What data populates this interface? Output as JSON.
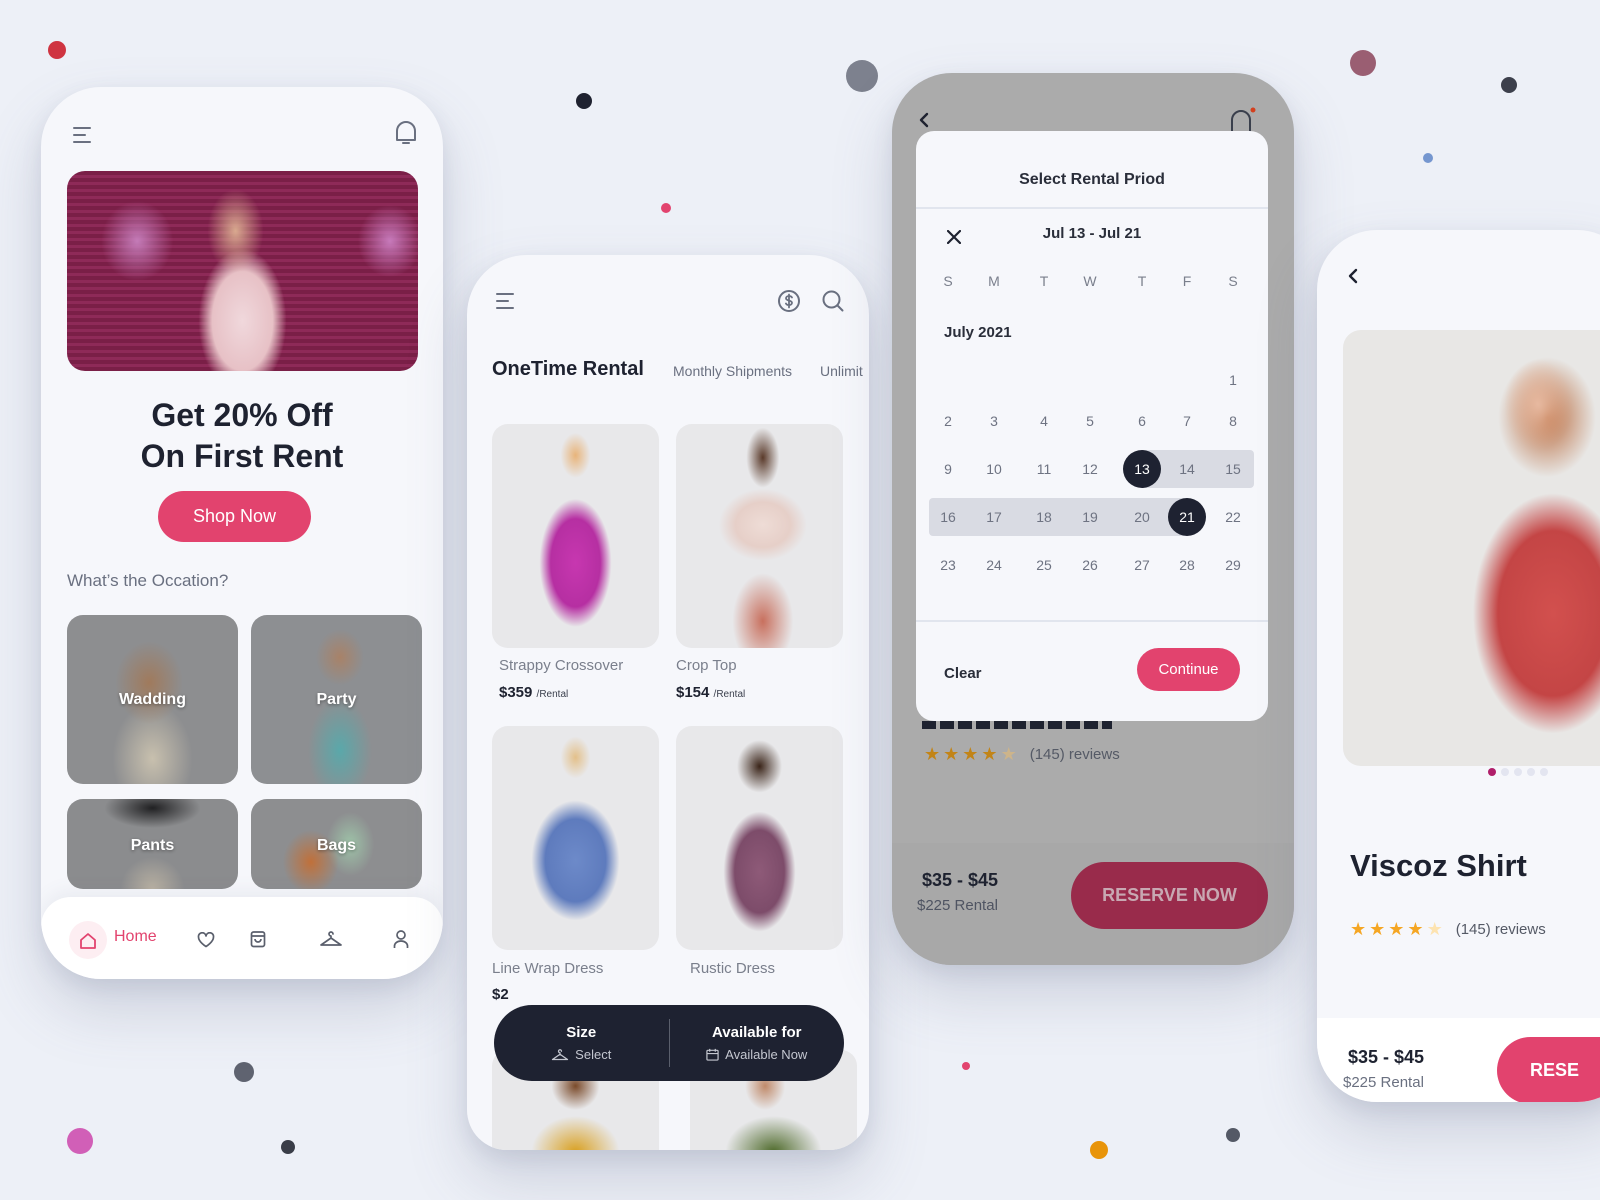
{
  "decor_dots": [
    {
      "color": "#cf3441"
    },
    {
      "color": "#1f2230"
    },
    {
      "color": "#7d818e"
    },
    {
      "color": "#e2436e"
    },
    {
      "color": "#9a5e72"
    },
    {
      "color": "#3d404c"
    },
    {
      "color": "#7596cf"
    },
    {
      "color": "#5f6370"
    },
    {
      "color": "#d15fb7"
    },
    {
      "color": "#3a3d48"
    },
    {
      "color": "#e2436e"
    },
    {
      "color": "#e8940a"
    },
    {
      "color": "#545966"
    }
  ],
  "colors": {
    "accent": "#e2436e",
    "dark": "#1e2231",
    "star": "#f5a623"
  },
  "home": {
    "menu_icon": "menu-icon",
    "bell_icon": "bell-icon",
    "promo_title": "Get 20% Off\nOn First Rent",
    "shop_now": "Shop Now",
    "occasion_label": "What’s the Occation?",
    "occasions": [
      {
        "label": "Wadding"
      },
      {
        "label": "Party"
      },
      {
        "label": "Pants"
      },
      {
        "label": "Bags"
      }
    ],
    "nav": {
      "home": "Home",
      "icons": [
        "home-icon",
        "heart-icon",
        "bag-icon",
        "hanger-icon",
        "user-icon"
      ]
    }
  },
  "catalog": {
    "tabs": [
      "OneTime Rental",
      "Monthly Shipments",
      "Unlimit"
    ],
    "products": [
      {
        "name": "Strappy Crossover",
        "price": "$359",
        "unit": "/Rental"
      },
      {
        "name": "Crop Top",
        "price": "$154",
        "unit": "/Rental"
      },
      {
        "name": "Line Wrap Dress",
        "price": "$2",
        "unit": ""
      },
      {
        "name": "Rustic Dress",
        "price": "",
        "unit": ""
      }
    ],
    "filter": {
      "size_title": "Size",
      "size_value": "Select",
      "avail_title": "Available for",
      "avail_value": "Available Now"
    }
  },
  "calendar": {
    "title": "Select Rental Priod",
    "range": "Jul 13 - Jul 21",
    "weekdays": [
      "S",
      "M",
      "T",
      "W",
      "T",
      "F",
      "S"
    ],
    "month": "July 2021",
    "range_start": 13,
    "range_end": 21,
    "clear": "Clear",
    "continue": "Continue",
    "behind": {
      "rating": 4,
      "reviews": "(145) reviews",
      "price_range": "$35 - $45",
      "price_sub": "$225 Rental",
      "reserve": "RESERVE NOW"
    }
  },
  "detail": {
    "title": "Viscoz Shirt",
    "rating": 4,
    "reviews": "(145) reviews",
    "carousel_index": 1,
    "carousel_count": 5,
    "price_range": "$35 - $45",
    "price_sub": "$225 Rental",
    "reserve": "RESE"
  }
}
